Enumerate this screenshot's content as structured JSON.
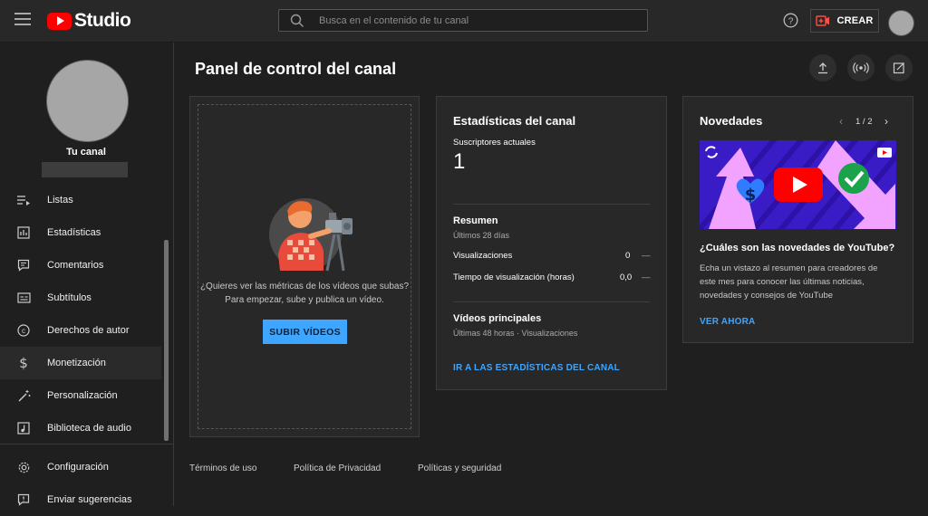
{
  "header": {
    "logo_text": "Studio",
    "search_placeholder": "Busca en el contenido de tu canal",
    "create_label": "CREAR"
  },
  "sidebar": {
    "channel_name": "Tu canal",
    "items": [
      {
        "label": "Listas",
        "icon": "playlist-icon"
      },
      {
        "label": "Estadísticas",
        "icon": "analytics-icon"
      },
      {
        "label": "Comentarios",
        "icon": "comments-icon"
      },
      {
        "label": "Subtítulos",
        "icon": "subtitles-icon"
      },
      {
        "label": "Derechos de autor",
        "icon": "copyright-icon"
      },
      {
        "label": "Monetización",
        "icon": "dollar-icon"
      },
      {
        "label": "Personalización",
        "icon": "magic-wand-icon"
      },
      {
        "label": "Biblioteca de audio",
        "icon": "audio-library-icon"
      }
    ],
    "bottom_items": [
      {
        "label": "Configuración",
        "icon": "gear-icon"
      },
      {
        "label": "Enviar sugerencias",
        "icon": "feedback-icon"
      }
    ]
  },
  "main": {
    "title": "Panel de control del canal",
    "upload_card": {
      "text_line1": "¿Quieres ver las métricas de los vídeos que subas?",
      "text_line2": "Para empezar, sube y publica un vídeo.",
      "button_label": "SUBIR VÍDEOS"
    },
    "stats_card": {
      "title": "Estadísticas del canal",
      "subs_label": "Suscriptores actuales",
      "subs_value": "1",
      "summary_title": "Resumen",
      "summary_period": "Últimos 28 días",
      "metrics": [
        {
          "label": "Visualizaciones",
          "value": "0",
          "trend": "—"
        },
        {
          "label": "Tiempo de visualización (horas)",
          "value": "0,0",
          "trend": "—"
        }
      ],
      "top_videos_title": "Vídeos principales",
      "top_videos_period": "Últimas 48 horas · Visualizaciones",
      "link_label": "IR A LAS ESTADÍSTICAS DEL CANAL"
    },
    "news_card": {
      "title": "Novedades",
      "pager": "1 / 2",
      "headline": "¿Cuáles son las novedades de YouTube?",
      "body_line1": "Echa un vistazo al resumen para creadores de",
      "body_line2": "este mes para conocer las últimas noticias,",
      "body_line3": "novedades y consejos de YouTube",
      "link_label": "VER AHORA"
    }
  },
  "footer": {
    "links": [
      "Términos de uso",
      "Política de Privacidad",
      "Políticas y seguridad"
    ]
  },
  "colors": {
    "accent_blue": "#3ea6ff",
    "brand_red": "#ff0000",
    "background": "#1f1f1f",
    "card": "#282828"
  }
}
